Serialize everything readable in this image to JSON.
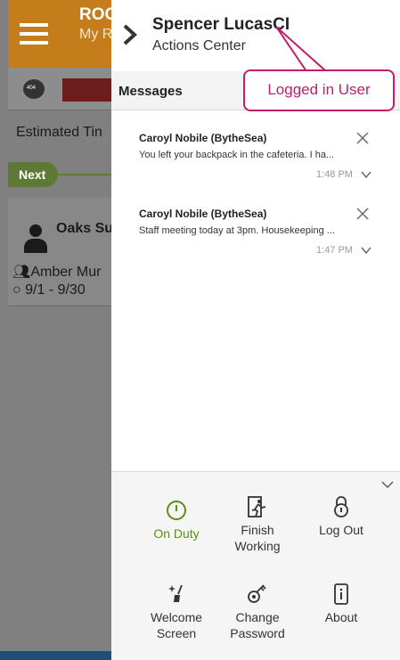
{
  "background_app": {
    "header_title": "ROC",
    "header_subtitle": "My Ro",
    "toolbar_badge": "404",
    "estimated_label": "Estimated Tin",
    "next_label": "Next",
    "card_title": "Oaks Su",
    "card_assignee": "Amber Mur",
    "card_dates": "9/1 - 9/30"
  },
  "drawer": {
    "user_name": "Spencer LucasCI",
    "subtitle": "Actions Center",
    "messages_title": "Messages",
    "messages": [
      {
        "sender": "Caroyl Nobile (BytheSea)",
        "text": "You left your backpack in the cafeteria. I ha...",
        "time": "1:48 PM"
      },
      {
        "sender": "Caroyl Nobile (BytheSea)",
        "text": "Staff meeting today at 3pm. Housekeeping ...",
        "time": "1:47 PM"
      }
    ],
    "actions": [
      {
        "label": "On Duty",
        "icon": "clock-icon"
      },
      {
        "label": "Finish Working",
        "icon": "exit-door-icon"
      },
      {
        "label": "Log Out",
        "icon": "padlock-icon"
      },
      {
        "label": "Welcome Screen",
        "icon": "sparkle-broom-icon"
      },
      {
        "label": "Change Password",
        "icon": "key-icon"
      },
      {
        "label": "About",
        "icon": "info-phone-icon"
      }
    ]
  },
  "annotation": {
    "label": "Logged in User"
  },
  "colors": {
    "header_orange": "#c47d1a",
    "on_duty_green": "#5e8c17",
    "annotation_magenta": "#c21d6b",
    "next_green": "#5c7a34"
  }
}
